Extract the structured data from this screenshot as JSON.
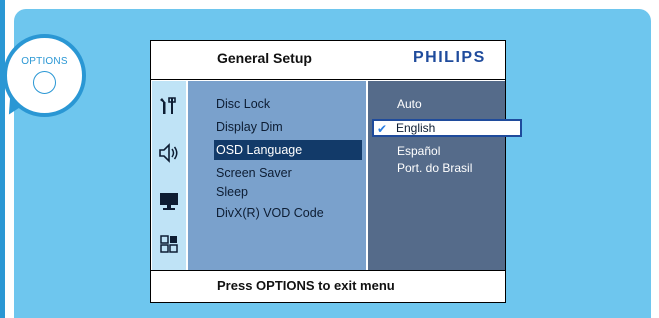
{
  "options_bubble": {
    "label": "OPTIONS"
  },
  "screen": {
    "title": "General Setup",
    "brand": "PHILIPS",
    "footer": "Press OPTIONS to exit menu"
  },
  "side_icons": [
    "settings-icon",
    "speaker-icon",
    "monitor-icon",
    "grid-icon"
  ],
  "menu": {
    "items": [
      {
        "label": "Disc Lock"
      },
      {
        "label": "Display Dim"
      },
      {
        "label": "OSD Language",
        "selected": true
      },
      {
        "label": "Screen Saver"
      },
      {
        "label": "Sleep"
      },
      {
        "label": "DivX(R) VOD Code"
      }
    ]
  },
  "options": {
    "items": [
      {
        "label": "Auto"
      },
      {
        "label": "English",
        "selected": true
      },
      {
        "label": "Español"
      },
      {
        "label": "Port. do Brasil"
      }
    ]
  },
  "colors": {
    "panel": "#6ec6ee",
    "accent": "#2a97d4",
    "brand": "#1f4b9c",
    "menu_bg": "#7aa1cc",
    "option_bg": "#556b8a",
    "selected_bg": "#123a69"
  }
}
